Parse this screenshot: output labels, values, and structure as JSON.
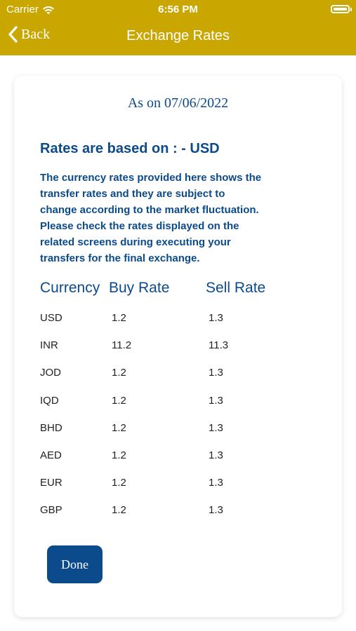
{
  "status_bar": {
    "carrier": "Carrier",
    "time": "6:56 PM"
  },
  "nav": {
    "back_label": "Back",
    "title": "Exchange Rates"
  },
  "as_on": "As on 07/06/2022",
  "based_on": "Rates are based on :  - USD",
  "description": "The currency rates provided here shows the\ntransfer rates and they are subject to\nchange according to the market fluctuation.\nPlease check the rates displayed on the\nrelated screens during executing your\ntransfers for the final exchange.",
  "table": {
    "headers": [
      "Currency",
      "Buy Rate",
      "Sell Rate"
    ],
    "rows": [
      [
        "USD",
        "1.2",
        "1.3"
      ],
      [
        "INR",
        "11.2",
        "11.3"
      ],
      [
        "JOD",
        "1.2",
        "1.3"
      ],
      [
        "IQD",
        "1.2",
        "1.3"
      ],
      [
        "BHD",
        "1.2",
        "1.3"
      ],
      [
        "AED",
        "1.2",
        "1.3"
      ],
      [
        "EUR",
        "1.2",
        "1.3"
      ],
      [
        "GBP",
        "1.2",
        "1.3"
      ]
    ]
  },
  "done_label": "Done",
  "colors": {
    "header_bg": "#c9a700",
    "accent_blue": "#0b4a8b"
  },
  "icons": {
    "wifi": "wifi-icon",
    "battery": "battery-icon",
    "back": "chevron-left-icon"
  }
}
